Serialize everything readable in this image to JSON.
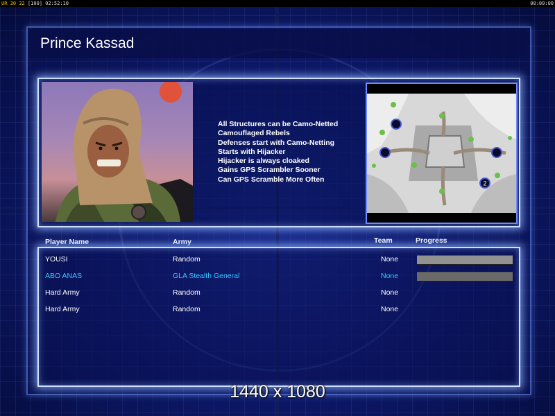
{
  "topbar": {
    "left_prefix": "UR",
    "left_nums": "30 32",
    "left_bracket": "[100]",
    "left_time": "02:52:10",
    "right_time": "00:00:00"
  },
  "header": {
    "title": "Prince Kassad"
  },
  "general": {
    "features": [
      "All Structures can be Camo-Netted",
      "Camouflaged Rebels",
      "Defenses start with Camo-Netting",
      "Starts with Hijacker",
      "Hijacker is always cloaked",
      "Gains GPS Scrambler Sooner",
      "Can GPS Scramble More Often"
    ]
  },
  "map": {
    "player_marker_label": "2"
  },
  "table": {
    "headers": {
      "player": "Player Name",
      "army": "Army",
      "team": "Team",
      "progress": "Progress"
    },
    "rows": [
      {
        "player": "YOUSI",
        "army": "Random",
        "team": "None",
        "progress": 1.0,
        "highlight": false
      },
      {
        "player": "ABO ANAS",
        "army": "GLA Stealth General",
        "team": "None",
        "progress": 0.0,
        "highlight": true
      },
      {
        "player": "Hard Army",
        "army": "Random",
        "team": "None",
        "progress": null,
        "highlight": false
      },
      {
        "player": "Hard Army",
        "army": "Random",
        "team": "None",
        "progress": null,
        "highlight": false
      }
    ]
  },
  "overlay": {
    "resolution": "1440 x 1080"
  },
  "colors": {
    "highlight": "#38c8ff",
    "panel_border": "#cfe0ff",
    "background": "#0e1a6e"
  }
}
